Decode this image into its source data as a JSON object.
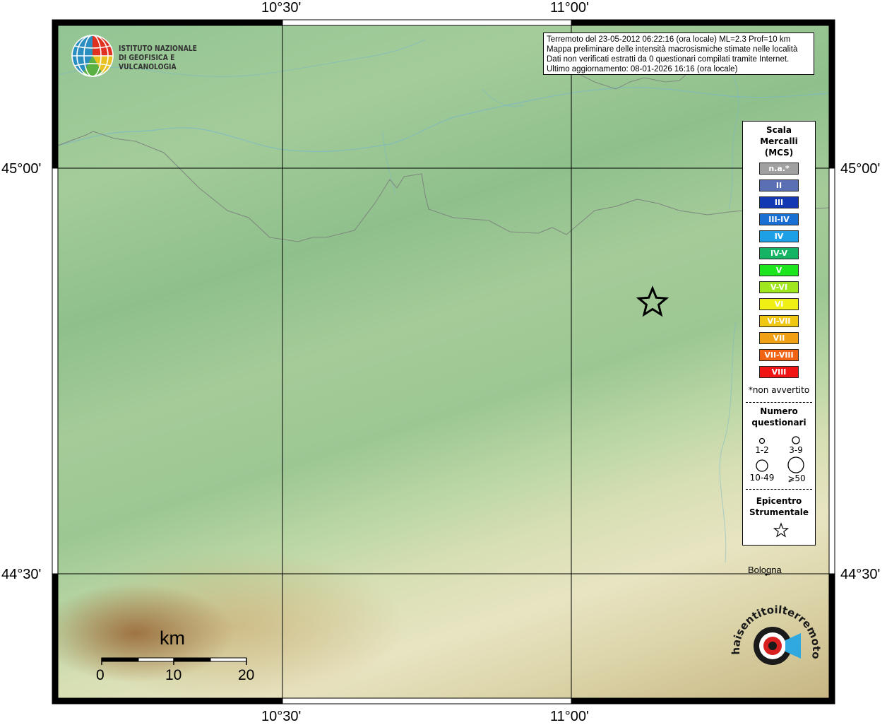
{
  "map": {
    "lon_labels_top": [
      "10°30'",
      "11°00'"
    ],
    "lon_labels_bottom": [
      "10°30'",
      "11°00'"
    ],
    "lat_labels_left": [
      "45°00'",
      "44°30'"
    ],
    "lat_labels_right": [
      "45°00'",
      "44°30'"
    ],
    "city": "Bologna",
    "epicenter_icon": "star-icon"
  },
  "logo": {
    "line1": "ISTITUTO NAZIONALE",
    "line2": "DI GEOFISICA E VULCANOLOGIA",
    "icon": "globe-icon"
  },
  "info": {
    "line1": "Terremoto del 23-05-2012 06:22:16 (ora locale) ML=2.3 Prof=10 km",
    "line2": "Mappa preliminare delle intensità macrosismiche stimate nelle località",
    "line3": "Dati non verificati estratti da 0 questionari compilati tramite Internet.",
    "line4": "Ultimo aggiornamento: 08-01-2026 16:16 (ora locale)"
  },
  "legend": {
    "title1": "Scala",
    "title2": "Mercalli",
    "title3": "(MCS)",
    "scale": [
      {
        "label": "n.a.*",
        "color": "#a0a0a0"
      },
      {
        "label": "II",
        "color": "#5b6fb4"
      },
      {
        "label": "III",
        "color": "#1238b4"
      },
      {
        "label": "III-IV",
        "color": "#1a6fd2"
      },
      {
        "label": "IV",
        "color": "#1ea0e6"
      },
      {
        "label": "IV-V",
        "color": "#14b464"
      },
      {
        "label": "V",
        "color": "#1ee61e"
      },
      {
        "label": "V-VI",
        "color": "#a0e61e"
      },
      {
        "label": "VI",
        "color": "#f0f014"
      },
      {
        "label": "VI-VII",
        "color": "#f0c814"
      },
      {
        "label": "VII",
        "color": "#f0a014"
      },
      {
        "label": "VII-VIII",
        "color": "#f06414"
      },
      {
        "label": "VIII",
        "color": "#f01414"
      }
    ],
    "note": "*non avvertito",
    "count_title1": "Numero",
    "count_title2": "questionari",
    "counts": [
      "1-2",
      "3-9",
      "10-49",
      "⩾50"
    ],
    "epi_title1": "Epicentro",
    "epi_title2": "Strumentale"
  },
  "scalebar": {
    "unit": "km",
    "ticks": [
      "0",
      "10",
      "20"
    ]
  },
  "watermark": {
    "text": "haisentitoilterremoto.it",
    "icon": "haisentito-logo-icon"
  }
}
